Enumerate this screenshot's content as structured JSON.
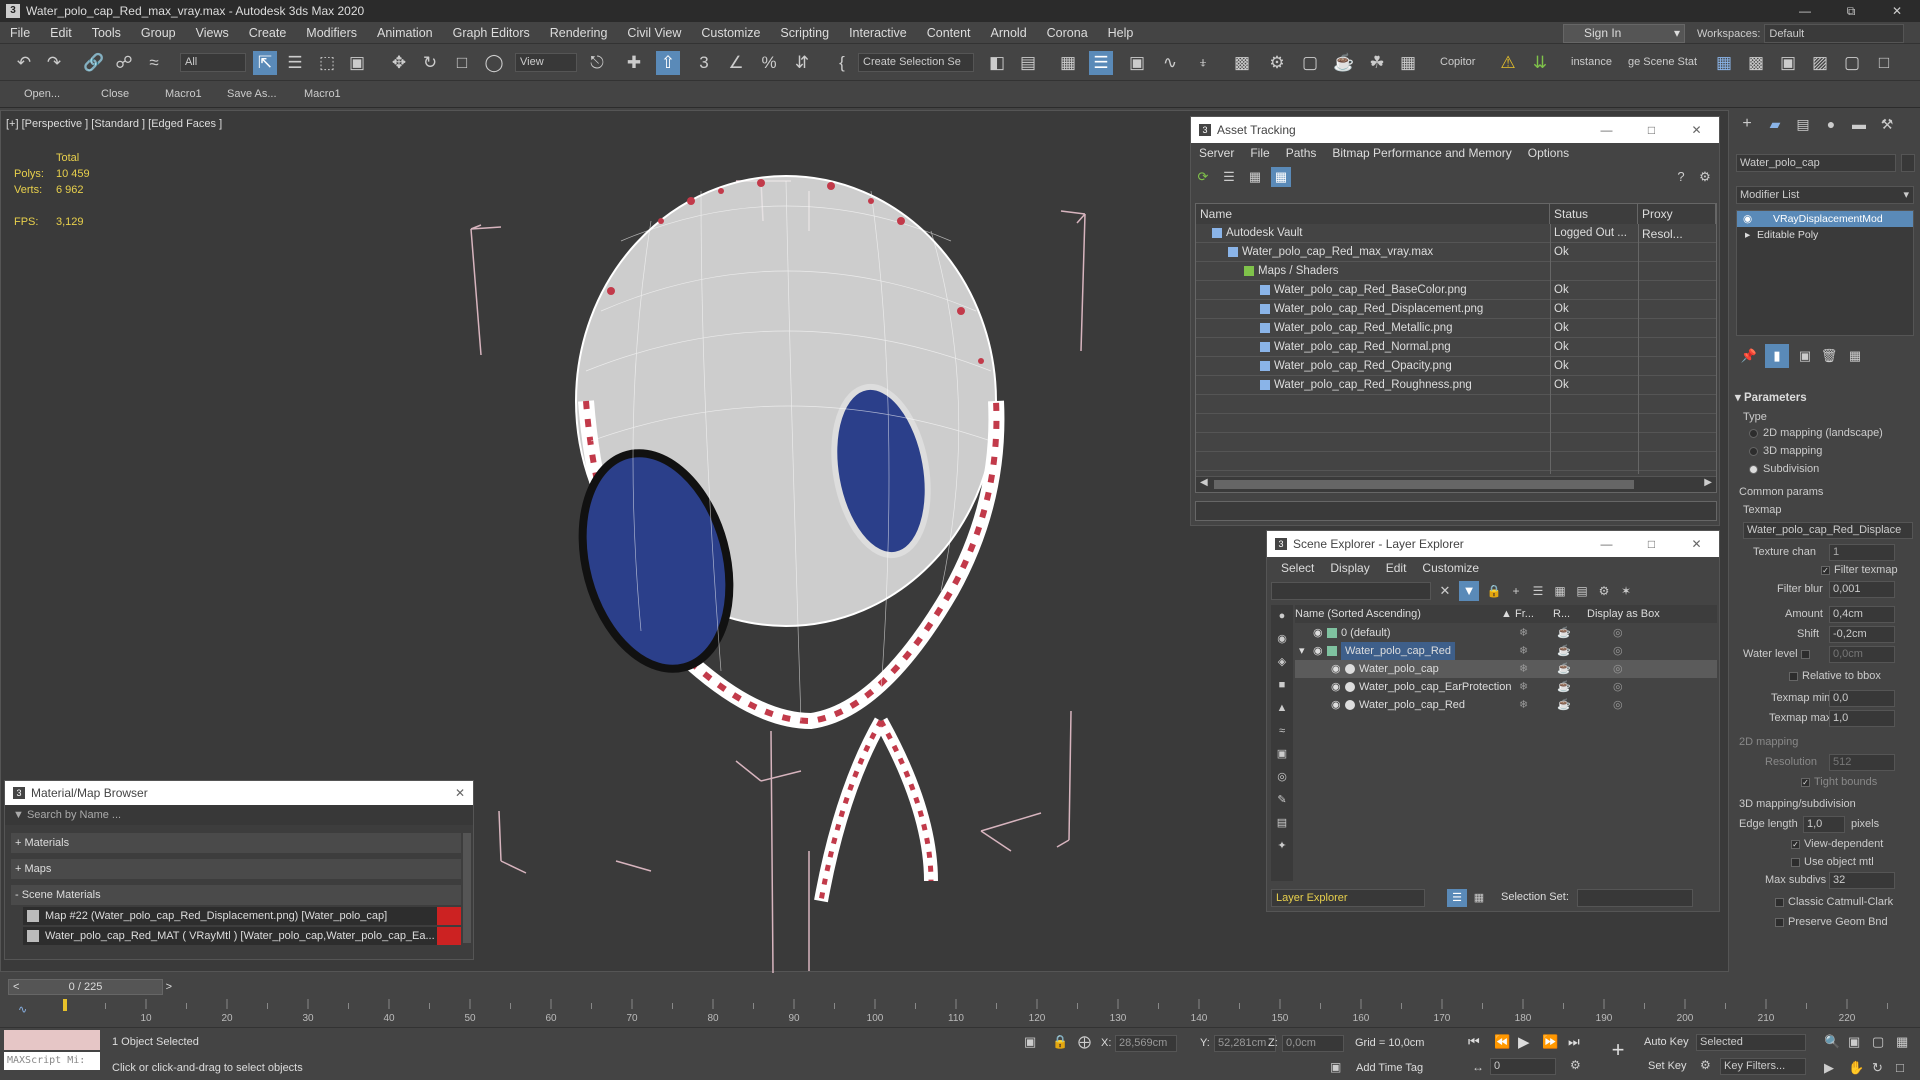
{
  "window": {
    "title": "Water_polo_cap_Red_max_vray.max - Autodesk 3ds Max 2020",
    "app_icon": "3"
  },
  "menu": [
    "File",
    "Edit",
    "Tools",
    "Group",
    "Views",
    "Create",
    "Modifiers",
    "Animation",
    "Graph Editors",
    "Rendering",
    "Civil View",
    "Customize",
    "Scripting",
    "Interactive",
    "Content",
    "Arnold",
    "Corona",
    "Help"
  ],
  "signin": "Sign In",
  "workspaces": {
    "label": "Workspaces:",
    "value": "Default"
  },
  "toolbar": {
    "filter": "All",
    "refcoord": "View",
    "selset": "Create Selection Se",
    "copitor": "Copitor",
    "instance": "instance",
    "scenestat": "ge Scene Stat"
  },
  "quickbar": [
    "Open...",
    "Close",
    "Macro1",
    "Save As...",
    "Macro1"
  ],
  "viewport": {
    "label": "[+] [Perspective ] [Standard ] [Edged Faces ]",
    "stats": {
      "total_label": "Total",
      "polys_label": "Polys:",
      "polys": "10 459",
      "verts_label": "Verts:",
      "verts": "6 962",
      "fps_label": "FPS:",
      "fps": "3,129"
    }
  },
  "asset_tracking": {
    "title": "Asset Tracking",
    "menu": [
      "Server",
      "File",
      "Paths",
      "Bitmap Performance and Memory",
      "Options"
    ],
    "columns": [
      "Name",
      "Status",
      "Proxy Resol..."
    ],
    "rows": [
      {
        "name": "Autodesk Vault",
        "status": "Logged Out ...",
        "indent": 1
      },
      {
        "name": "Water_polo_cap_Red_max_vray.max",
        "status": "Ok",
        "indent": 2
      },
      {
        "name": "Maps / Shaders",
        "status": "",
        "indent": 3
      },
      {
        "name": "Water_polo_cap_Red_BaseColor.png",
        "status": "Ok",
        "indent": 4
      },
      {
        "name": "Water_polo_cap_Red_Displacement.png",
        "status": "Ok",
        "indent": 4
      },
      {
        "name": "Water_polo_cap_Red_Metallic.png",
        "status": "Ok",
        "indent": 4
      },
      {
        "name": "Water_polo_cap_Red_Normal.png",
        "status": "Ok",
        "indent": 4
      },
      {
        "name": "Water_polo_cap_Red_Opacity.png",
        "status": "Ok",
        "indent": 4
      },
      {
        "name": "Water_polo_cap_Red_Roughness.png",
        "status": "Ok",
        "indent": 4
      }
    ]
  },
  "scene_explorer": {
    "title": "Scene Explorer - Layer Explorer",
    "menu": [
      "Select",
      "Display",
      "Edit",
      "Customize"
    ],
    "columns": [
      "Name (Sorted Ascending)",
      "Fr...",
      "R...",
      "Display as Box"
    ],
    "rows": [
      {
        "name": "0 (default)",
        "indent": 0
      },
      {
        "name": "Water_polo_cap_Red",
        "indent": 0,
        "highlight": true
      },
      {
        "name": "Water_polo_cap",
        "indent": 1,
        "selected": true
      },
      {
        "name": "Water_polo_cap_EarProtection",
        "indent": 1
      },
      {
        "name": "Water_polo_cap_Red",
        "indent": 1
      }
    ],
    "footer_label": "Layer Explorer",
    "selection_set_label": "Selection Set:"
  },
  "material_browser": {
    "title": "Material/Map Browser",
    "search_placeholder": "Search by Name ...",
    "sections": [
      "+ Materials",
      "+ Maps",
      "- Scene Materials"
    ],
    "items": [
      "Map #22 (Water_polo_cap_Red_Displacement.png) [Water_polo_cap]",
      "Water_polo_cap_Red_MAT ( VRayMtl ) [Water_polo_cap,Water_polo_cap_Ea..."
    ]
  },
  "command_panel": {
    "object_name": "Water_polo_cap",
    "modifier_list": "Modifier List",
    "stack": [
      "VRayDisplacementMod",
      "Editable Poly"
    ],
    "params_title": "Parameters",
    "type_label": "Type",
    "type_options": [
      "2D mapping (landscape)",
      "3D mapping",
      "Subdivision"
    ],
    "type_selected": 2,
    "common_params": "Common params",
    "texmap_label": "Texmap",
    "texmap_value": "Water_polo_cap_Red_Displace",
    "texture_chan_label": "Texture chan",
    "texture_chan": "1",
    "filter_texmap": "Filter texmap",
    "filter_blur_label": "Filter blur",
    "filter_blur": "0,001",
    "amount_label": "Amount",
    "amount": "0,4cm",
    "shift_label": "Shift",
    "shift": "-0,2cm",
    "water_level_label": "Water level",
    "water_level": "0,0cm",
    "relative_bbox": "Relative to bbox",
    "texmap_min_label": "Texmap min",
    "texmap_min": "0,0",
    "texmap_max_label": "Texmap max",
    "texmap_max": "1,0",
    "mapping2d_label": "2D mapping",
    "resolution_label": "Resolution",
    "resolution": "512",
    "tight_bounds": "Tight bounds",
    "mapping3d_label": "3D mapping/subdivision",
    "edge_length_label": "Edge length",
    "edge_length": "1,0",
    "pixels": "pixels",
    "view_dependent": "View-dependent",
    "use_object_mtl": "Use object mtl",
    "max_subdivs_label": "Max subdivs",
    "max_subdivs": "32",
    "classic_catmull": "Classic Catmull-Clark",
    "preserve_geom": "Preserve Geom Bnd"
  },
  "timeline": {
    "frame": "0 / 225",
    "ticks": [
      "10",
      "20",
      "30",
      "40",
      "50",
      "60",
      "70",
      "80",
      "90",
      "100",
      "110",
      "120",
      "130",
      "140",
      "150",
      "160",
      "170",
      "180",
      "190",
      "200",
      "210",
      "220"
    ]
  },
  "status": {
    "selected": "1 Object Selected",
    "prompt": "Click or click-and-drag to select objects",
    "maxscript": "MAXScript Mi:",
    "x_label": "X:",
    "x": "28,569cm",
    "y_label": "Y:",
    "y": "52,281cm",
    "z_label": "Z:",
    "z": "0,0cm",
    "grid": "Grid = 10,0cm",
    "add_time_tag": "Add Time Tag",
    "auto_key": "Auto Key",
    "set_key": "Set Key",
    "selected_dd": "Selected",
    "key_filters": "Key Filters...",
    "frame_field": "0"
  }
}
